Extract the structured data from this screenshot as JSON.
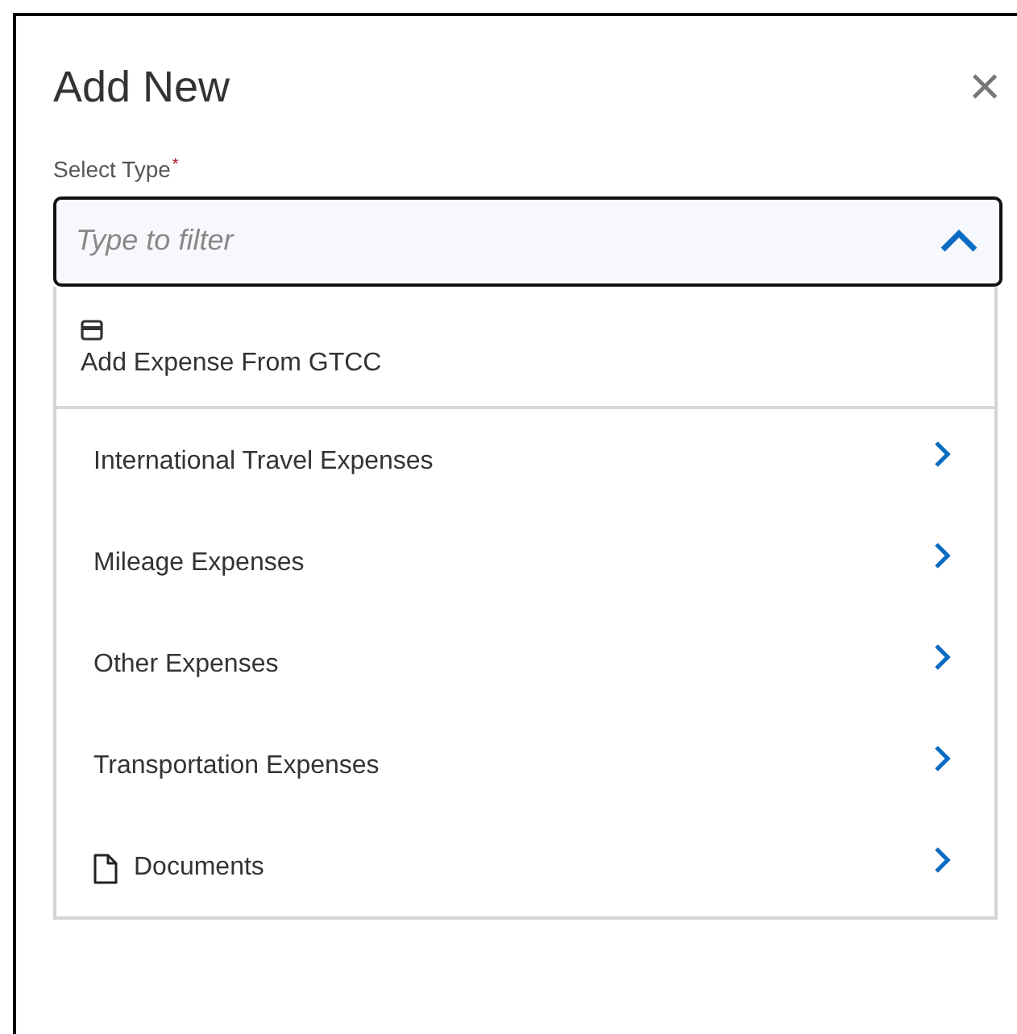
{
  "dialog": {
    "title": "Add New",
    "close": "×"
  },
  "field": {
    "label": "Select Type",
    "required_mark": "*",
    "placeholder": "Type to filter",
    "expanded": true
  },
  "options": [
    {
      "kind": "card",
      "label": "Add Expense From GTCC"
    },
    {
      "kind": "plain",
      "label": "International Travel Expenses"
    },
    {
      "kind": "plain",
      "label": "Mileage Expenses"
    },
    {
      "kind": "plain",
      "label": "Other Expenses"
    },
    {
      "kind": "plain",
      "label": "Transportation Expenses"
    },
    {
      "kind": "document",
      "label": "Documents"
    }
  ]
}
